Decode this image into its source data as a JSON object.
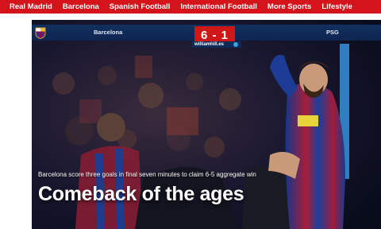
{
  "nav": {
    "items": [
      {
        "label": "Real Madrid"
      },
      {
        "label": "Barcelona"
      },
      {
        "label": "Spanish Football"
      },
      {
        "label": "International Football"
      },
      {
        "label": "More Sports"
      },
      {
        "label": "Lifestyle"
      }
    ],
    "background_color": "#d4131b"
  },
  "scoreboard": {
    "home_team": "Barcelona",
    "away_team": "PSG",
    "score": "6 - 1",
    "sponsor": "williamhill.es",
    "home_crest_icon": "barcelona-crest-icon",
    "accent_color": "#d01717"
  },
  "article": {
    "subtitle": "Barcelona score three goals in final seven minutes to claim 6-5 aggregate win",
    "headline": "Comeback of the ages"
  }
}
